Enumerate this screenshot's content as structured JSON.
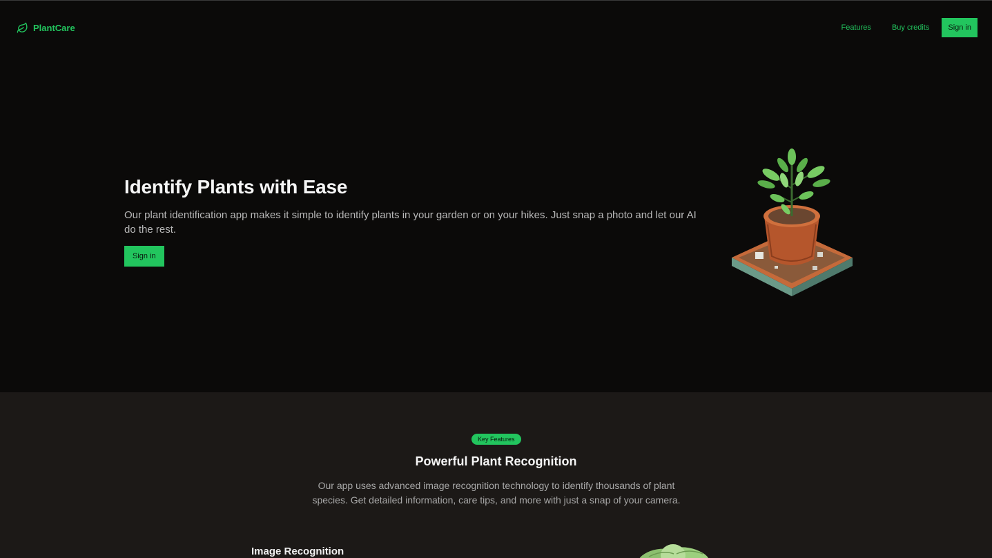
{
  "header": {
    "brand": "PlantCare",
    "brand_icon": "leaf-icon",
    "nav": [
      {
        "label": "Features"
      },
      {
        "label": "Buy credits"
      }
    ],
    "sign_in_label": "Sign in"
  },
  "hero": {
    "title": "Identify Plants with Ease",
    "description": "Our plant identification app makes it simple to identify plants in your garden or on your hikes. Just snap a photo and let our AI do the rest.",
    "cta_label": "Sign in"
  },
  "features": {
    "badge": "Key Features",
    "title": "Powerful Plant Recognition",
    "description": "Our app uses advanced image recognition technology to identify thousands of plant species. Get detailed information, care tips, and more with just a snap of your camera.",
    "first_item_title": "Image Recognition"
  },
  "colors": {
    "accent": "#22c55e",
    "background": "#0b0a09",
    "section_background": "#1c1917"
  }
}
